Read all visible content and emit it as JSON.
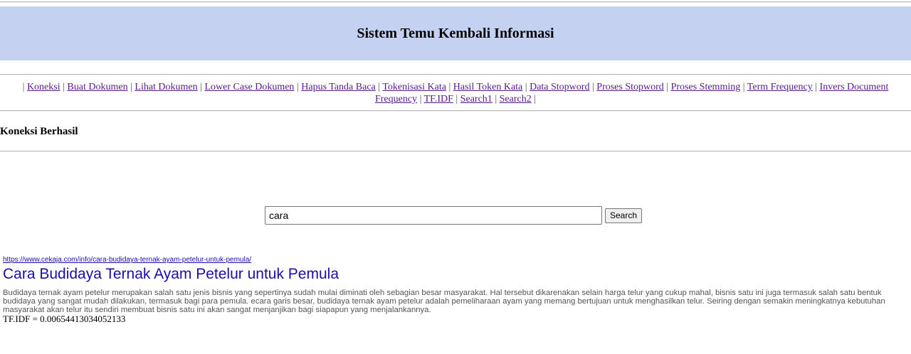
{
  "header": {
    "title": "Sistem Temu Kembali Informasi"
  },
  "nav": {
    "items": [
      "Koneksi",
      "Buat Dokumen",
      "Lihat Dokumen",
      "Lower Case Dokumen",
      "Hapus Tanda Baca",
      "Tokenisasi Kata",
      "Hasil Token Kata",
      "Data Stopword",
      "Proses Stopword",
      "Proses Stemming",
      "Term Frequency",
      "Invers Document Frequency",
      "TF.IDF",
      "Search1",
      "Search2"
    ]
  },
  "status": {
    "text": "Koneksi Berhasil"
  },
  "search": {
    "value": "cara",
    "button_label": "Search"
  },
  "result": {
    "url": "https://www.cekaja.com/info/cara-budidaya-ternak-ayam-petelur-untuk-pemula/",
    "title": "Cara Budidaya Ternak Ayam Petelur untuk Pemula",
    "snippet": "Budidaya ternak ayam petelur merupakan salah satu jenis bisnis yang sepertinya sudah mulai diminati oleh sebagian besar masyarakat. Hal tersebut dikarenakan selain harga telur yang cukup mahal, bisnis satu ini juga termasuk salah satu bentuk budidaya yang sangat mudah dilakukan, termasuk bagi para pemula. ecara garis besar, budidaya ternak ayam petelur adalah pemeliharaan ayam yang memang bertujuan untuk menghasilkan telur. Seiring dengan semakin meningkatnya kebutuhan masyarakat akan telur itu sendiri membuat bisnis satu ini akan sangat menjanjikan bagi siapapun yang menjalankannya.",
    "score": "TF.IDF = 0.00654413034052133"
  }
}
